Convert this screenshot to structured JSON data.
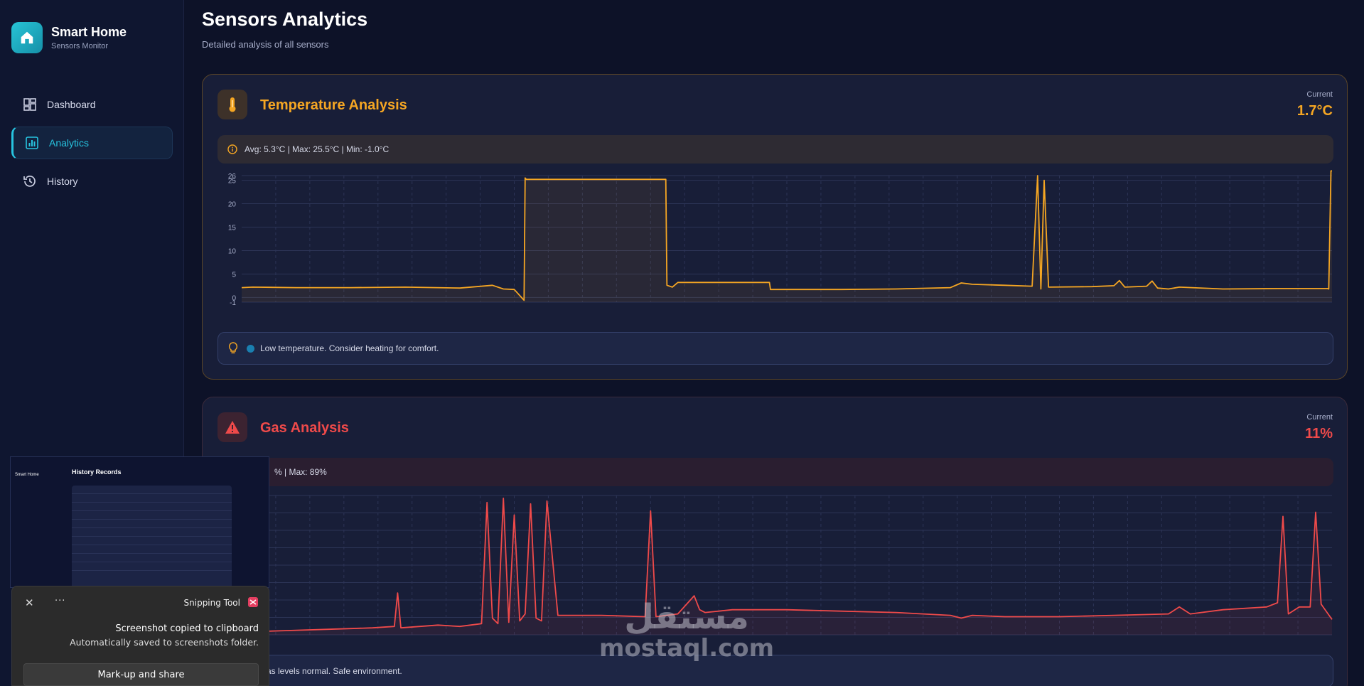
{
  "brand": {
    "title": "Smart Home",
    "subtitle": "Sensors Monitor",
    "icon": "home-icon"
  },
  "nav": {
    "items": [
      {
        "label": "Dashboard",
        "icon": "dashboard-icon",
        "active": false
      },
      {
        "label": "Analytics",
        "icon": "analytics-icon",
        "active": true
      },
      {
        "label": "History",
        "icon": "history-icon",
        "active": false
      }
    ]
  },
  "page": {
    "title": "Sensors Analytics",
    "subtitle": "Detailed analysis of all sensors"
  },
  "temperature": {
    "title": "Temperature Analysis",
    "current_label": "Current",
    "current_value": "1.7°C",
    "stats": "Avg: 5.3°C | Max: 25.5°C | Min: -1.0°C",
    "tip": "Low temperature. Consider heating for comfort.",
    "color": "#f5a623"
  },
  "gas": {
    "title": "Gas Analysis",
    "current_label": "Current",
    "current_value": "11%",
    "stats": "% | Max: 89%",
    "tip": "as levels normal. Safe environment.",
    "color": "#ef4a4a"
  },
  "snipping_tool": {
    "app_name": "Snipping Tool",
    "message": "Screenshot copied to clipboard",
    "detail": "Automatically saved to screenshots folder.",
    "action": "Mark-up and share",
    "preview_title": "History Records",
    "preview_brand": "Smart Home"
  },
  "watermark": {
    "arabic": "مستقل",
    "latin": "mostaql.com"
  },
  "chart_data": [
    {
      "type": "line",
      "title": "",
      "xlabel": "",
      "ylabel": "",
      "ylim": [
        -1,
        26
      ],
      "yticks": [
        -1,
        0,
        5,
        10,
        15,
        20,
        25,
        26
      ],
      "grid": true,
      "series": [
        {
          "color": "#f5a623",
          "fill": true,
          "x": [
            0,
            1,
            5,
            10,
            15,
            20,
            23,
            24,
            25,
            25.9,
            26,
            26.1,
            30,
            35,
            38.9,
            39,
            39.5,
            40,
            45,
            48.4,
            48.5,
            55,
            60,
            65,
            66,
            67,
            70,
            72.5,
            73,
            73.3,
            73.6,
            74,
            78,
            80,
            80.5,
            81,
            83,
            83.5,
            84,
            85,
            86,
            90,
            95,
            99.6,
            99.7,
            99.9,
            100
          ],
          "values": [
            2.1,
            2.2,
            2.1,
            2.1,
            2.2,
            2.0,
            2.6,
            1.8,
            1.7,
            -0.6,
            25.5,
            25.2,
            25.2,
            25.2,
            25.2,
            2.6,
            2.2,
            3.2,
            3.2,
            3.2,
            1.7,
            1.7,
            1.8,
            2.1,
            3.1,
            2.8,
            2.6,
            2.4,
            26,
            1.8,
            25.0,
            2.2,
            2.3,
            2.5,
            3.6,
            2.2,
            2.4,
            3.5,
            2.0,
            1.8,
            2.2,
            1.8,
            1.9,
            1.9,
            1.8,
            27.0,
            27.0
          ]
        }
      ]
    },
    {
      "type": "line",
      "title": "",
      "xlabel": "",
      "ylabel": "",
      "ylim": [
        0,
        100
      ],
      "grid": true,
      "series": [
        {
          "color": "#ef4a4a",
          "fill": true,
          "x": [
            0,
            4,
            8,
            12,
            14,
            14.3,
            14.6,
            18,
            20,
            22,
            22.5,
            23,
            23.5,
            24,
            24.5,
            25,
            25.5,
            26,
            26.5,
            27,
            27.5,
            28,
            29,
            29.5,
            30,
            33,
            37,
            37.5,
            38,
            40,
            41.5,
            42,
            42.5,
            45,
            50,
            55,
            60,
            65,
            66,
            67,
            70,
            75,
            80,
            85,
            86,
            87,
            90,
            94,
            95,
            95.5,
            96,
            97,
            98,
            98.5,
            99,
            100
          ],
          "values": [
            2,
            3,
            4,
            5,
            6,
            30,
            5,
            7,
            6,
            8,
            95,
            12,
            8,
            98,
            9,
            86,
            10,
            15,
            94,
            12,
            10,
            96,
            14,
            14,
            14,
            14,
            13,
            89,
            13,
            15,
            28,
            18,
            16,
            18,
            18,
            17,
            16,
            14,
            12,
            14,
            13,
            13,
            14,
            15,
            20,
            15,
            18,
            20,
            23,
            85,
            15,
            20,
            20,
            88,
            22,
            11
          ]
        }
      ]
    }
  ]
}
